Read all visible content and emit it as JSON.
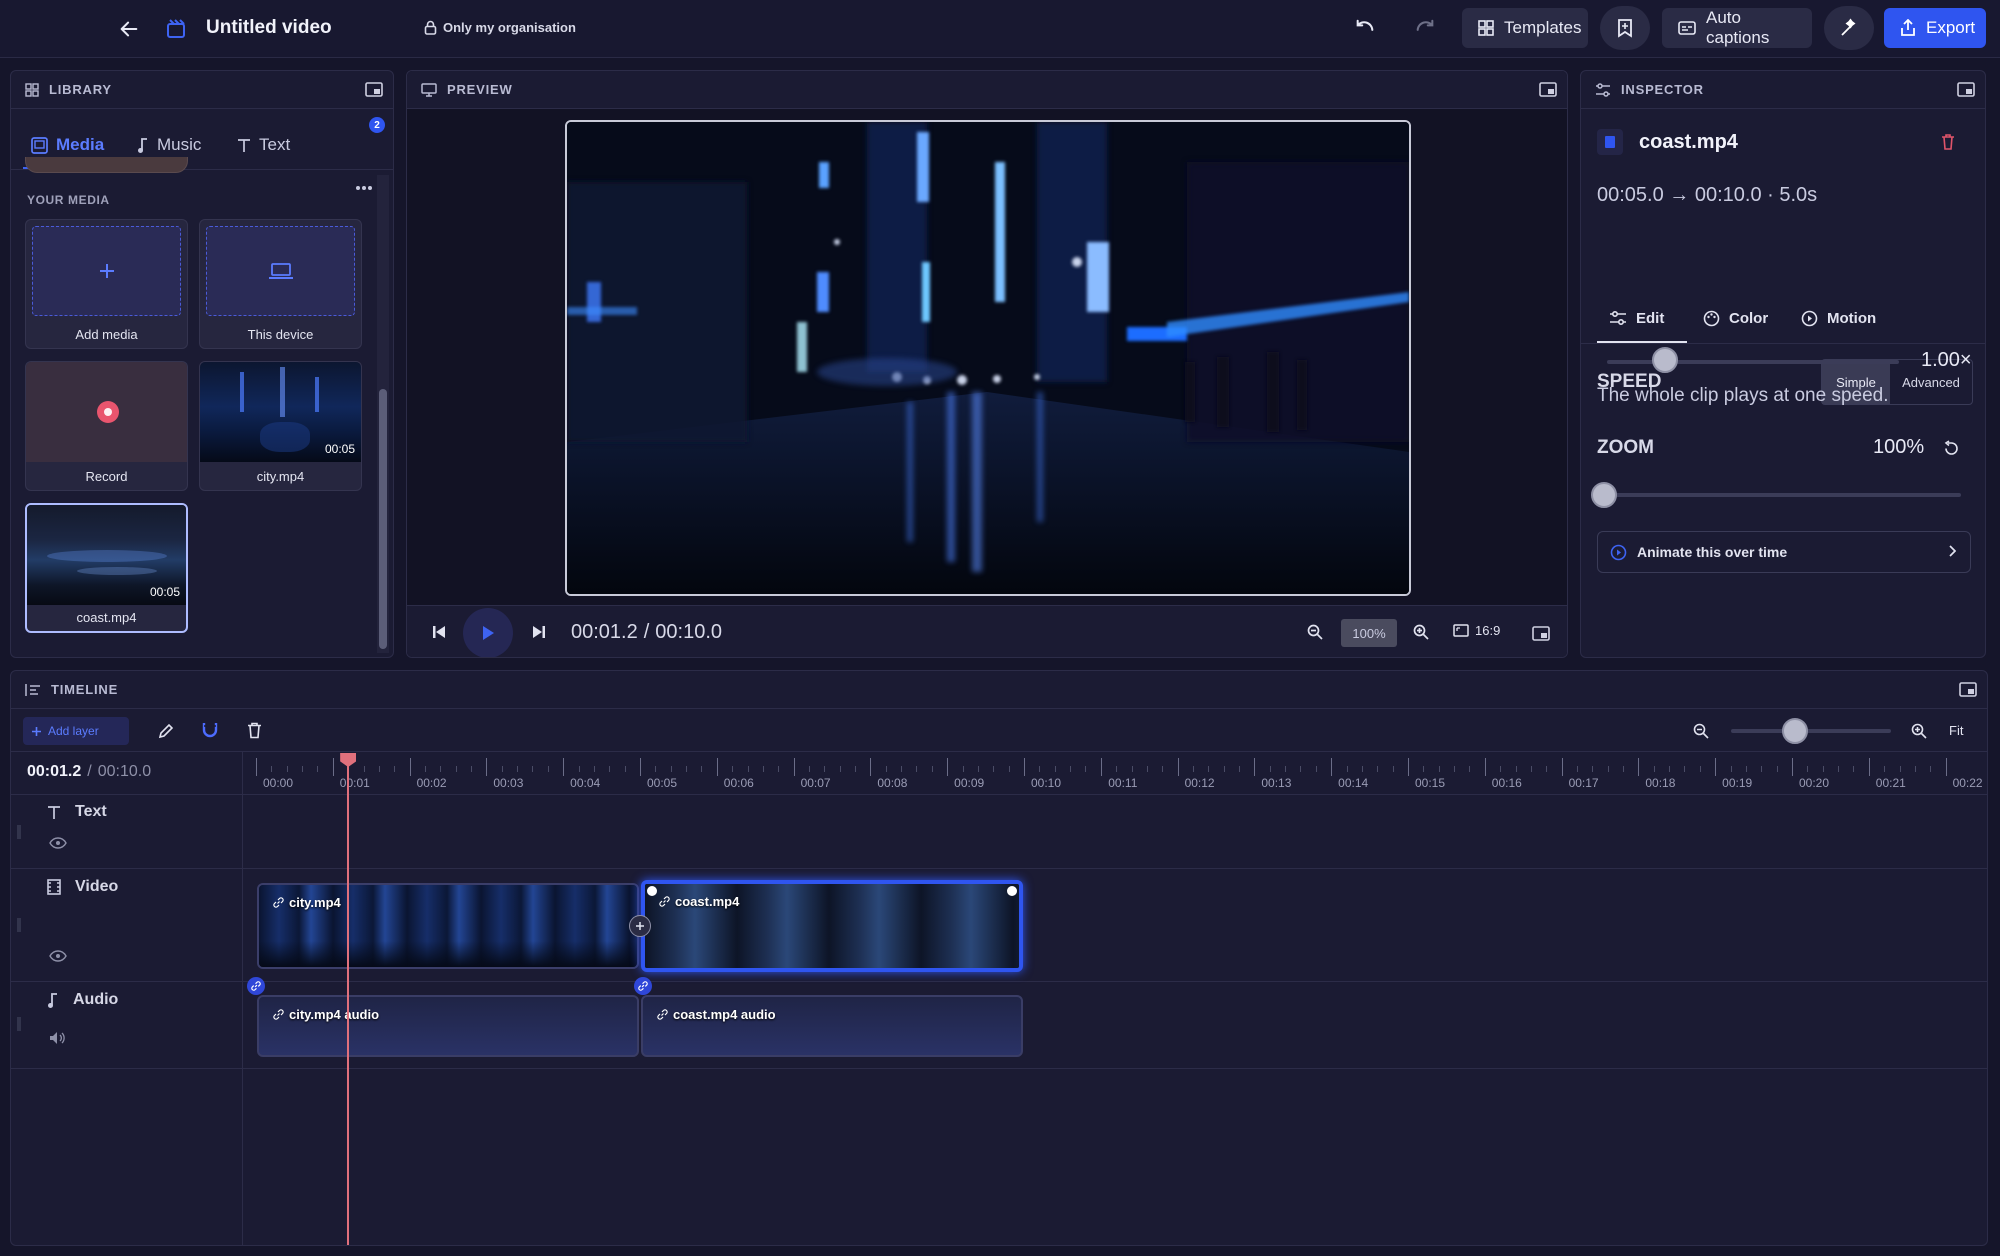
{
  "app": {
    "title": "Untitled video",
    "privacy": "Only my organisation",
    "templates_label": "Templates",
    "auto_captions_label": "Auto captions",
    "export_label": "Export"
  },
  "library": {
    "header": "LIBRARY",
    "tabs": [
      {
        "label": "Media",
        "active": true
      },
      {
        "label": "Music",
        "active": false
      },
      {
        "label": "Text",
        "active": false
      }
    ],
    "more_badge": "2",
    "section_title": "YOUR MEDIA",
    "tiles": [
      {
        "label": "Add media",
        "icon": "plus-icon"
      },
      {
        "label": "This device",
        "icon": "laptop-icon"
      },
      {
        "label": "Record",
        "icon": "record-icon"
      },
      {
        "label": "city.mp4",
        "duration": "00:05"
      },
      {
        "label": "coast.mp4",
        "duration": "00:05",
        "selected": true
      }
    ]
  },
  "preview": {
    "header": "PREVIEW",
    "current_time": "00:01.2",
    "separator": "/",
    "total_time": "00:10.0",
    "zoom": "100%",
    "aspect": "16:9"
  },
  "inspector": {
    "header": "INSPECTOR",
    "clip_name": "coast.mp4",
    "range": "00:05.0 → 00:10.0 · 5.0s",
    "tabs": [
      {
        "label": "Edit",
        "active": true,
        "icon": "sliders-icon"
      },
      {
        "label": "Color",
        "active": false,
        "icon": "palette-icon"
      },
      {
        "label": "Motion",
        "active": false,
        "icon": "motion-icon"
      }
    ],
    "speed": {
      "title": "SPEED",
      "modes": [
        "Simple",
        "Advanced"
      ],
      "active_mode": "Simple",
      "value": "1.00×",
      "level": 0.2,
      "description": "The whole clip plays at one speed."
    },
    "zoom": {
      "title": "ZOOM",
      "value": "100%",
      "level": 0.0
    },
    "animate_label": "Animate this over time"
  },
  "timeline": {
    "header": "TIMELINE",
    "add_layer_label": "Add layer",
    "current_time": "00:01.2",
    "separator": "/",
    "total_time": "00:10.0",
    "fit_label": "Fit",
    "zoom_level": 0.4,
    "playhead_seconds": 1.2,
    "ruler_labels": [
      "00:00",
      "00:01",
      "00:02",
      "00:03",
      "00:04",
      "00:05",
      "00:06",
      "00:07",
      "00:08",
      "00:09",
      "00:10",
      "00:11",
      "00:12",
      "00:13",
      "00:14",
      "00:15",
      "00:16",
      "00:17",
      "00:18",
      "00:19",
      "00:20",
      "00:21",
      "00:22"
    ],
    "tracks": [
      {
        "name": "Text",
        "icon": "text-icon"
      },
      {
        "name": "Video",
        "icon": "film-icon"
      },
      {
        "name": "Audio",
        "icon": "music-note-icon"
      }
    ],
    "video_clips": [
      {
        "label": "city.mp4",
        "start": 0,
        "end": 5
      },
      {
        "label": "coast.mp4",
        "start": 5,
        "end": 10,
        "selected": true
      }
    ],
    "audio_clips": [
      {
        "label": "city.mp4 audio",
        "start": 0,
        "end": 5
      },
      {
        "label": "coast.mp4 audio",
        "start": 5,
        "end": 10
      }
    ]
  },
  "colors": {
    "accent": "#2f55f0",
    "playhead": "#e0707c",
    "background": "#15152a",
    "panel": "#1b1b33"
  }
}
